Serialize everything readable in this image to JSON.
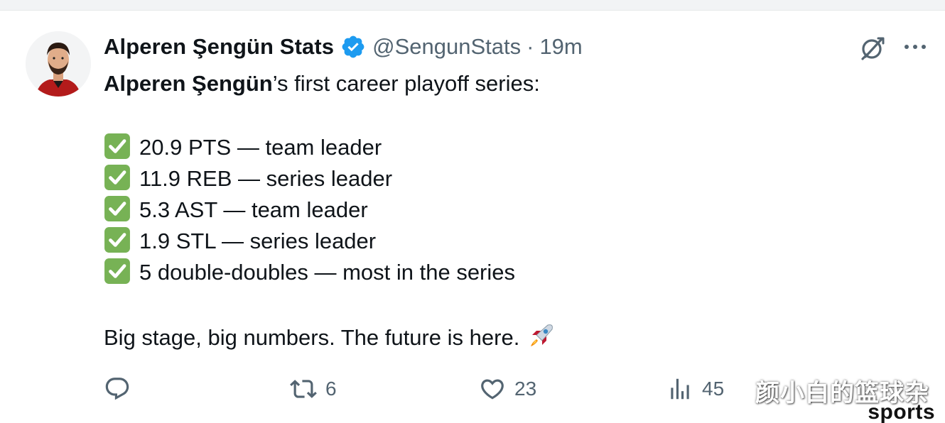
{
  "tweet": {
    "author": {
      "display_name": "Alperen Şengün Stats",
      "handle": "@SengunStats",
      "time": "19m",
      "separator": "·",
      "verified": true,
      "avatar_icon": "player-avatar"
    },
    "lines": {
      "intro_bold": "Alperen Şengün",
      "intro_rest": "’s first career playoff series:",
      "stat1": "20.9 PTS — team leader",
      "stat2": "11.9 REB — series leader",
      "stat3": "5.3 AST — team leader",
      "stat4": "1.9 STL — series leader",
      "stat5": "5 double-doubles — most in the series",
      "closing": "Big stage, big numbers. The future is here."
    },
    "emoji": {
      "check": "check-mark-button-icon",
      "rocket": "rocket-icon"
    },
    "actions": {
      "reply_count": "",
      "retweet_count": "6",
      "like_count": "23",
      "views_count": "45"
    }
  },
  "watermark": {
    "cn": "颜小白的篮球杂",
    "en": "sports"
  },
  "colors": {
    "text": "#0f1419",
    "secondary": "#536471",
    "verified_blue": "#1d9bf0",
    "check_green": "#77b255"
  }
}
